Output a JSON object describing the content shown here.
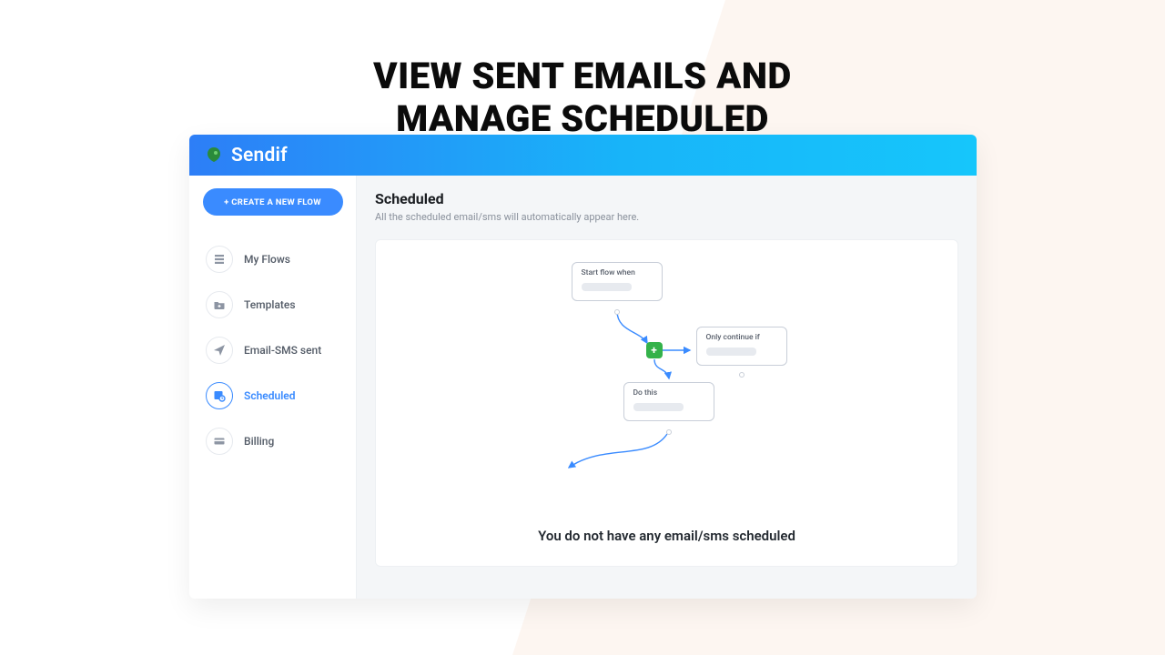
{
  "hero": {
    "title": "VIEW SENT EMAILS AND MANAGE SCHEDULED"
  },
  "app": {
    "brand": "Sendif",
    "sidebar": {
      "create_button": "+ CREATE A NEW FLOW",
      "items": [
        {
          "key": "my-flows",
          "label": "My Flows",
          "active": false
        },
        {
          "key": "templates",
          "label": "Templates",
          "active": false
        },
        {
          "key": "email-sms",
          "label": "Email-SMS sent",
          "active": false
        },
        {
          "key": "scheduled",
          "label": "Scheduled",
          "active": true
        },
        {
          "key": "billing",
          "label": "Billing",
          "active": false
        }
      ]
    },
    "page": {
      "title": "Scheduled",
      "subtitle": "All the scheduled email/sms will automatically appear here.",
      "empty_state": {
        "message": "You do not have any email/sms scheduled",
        "flow_nodes": {
          "start": "Start flow when",
          "continue": "Only continue if",
          "action": "Do this"
        }
      }
    }
  },
  "colors": {
    "accent": "#3a8bff",
    "header_gradient_from": "#2d7ef7",
    "header_gradient_to": "#16c6fb",
    "success": "#34b24a"
  }
}
